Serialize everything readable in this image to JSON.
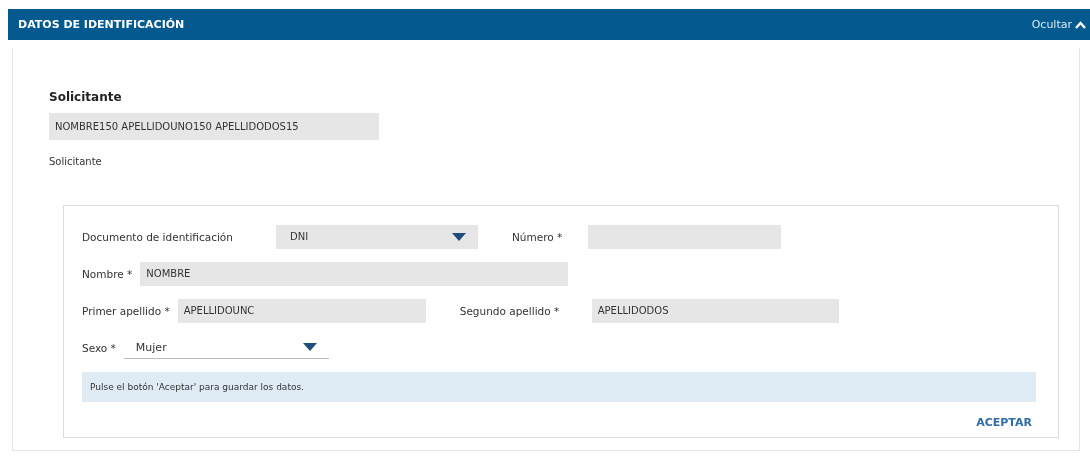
{
  "header": {
    "title": "DATOS DE IDENTIFICACIÓN",
    "toggle": "Ocultar",
    "expanded": true
  },
  "solicitante": {
    "heading": "Solicitante",
    "value": "NOMBRE150 APELLIDOUNO150 APELLIDODOS15",
    "caption": "Solicitante"
  },
  "form": {
    "documento": {
      "label": "Documento de identificación",
      "value": "DNI"
    },
    "numero": {
      "label": "Número *"
    },
    "nombre": {
      "label": "Nombre *",
      "value": "NOMBRE"
    },
    "primer_apellido": {
      "label": "Primer apellido *",
      "value": "APELLIDOUNC"
    },
    "segundo_apellido": {
      "label": "Segundo apellido *",
      "value": "APELLIDODOS"
    },
    "sexo": {
      "label": "Sexo *",
      "value": "Mujer"
    },
    "info": "Pulse el botón 'Aceptar' para guardar los datos.",
    "button": "ACEPTAR"
  }
}
